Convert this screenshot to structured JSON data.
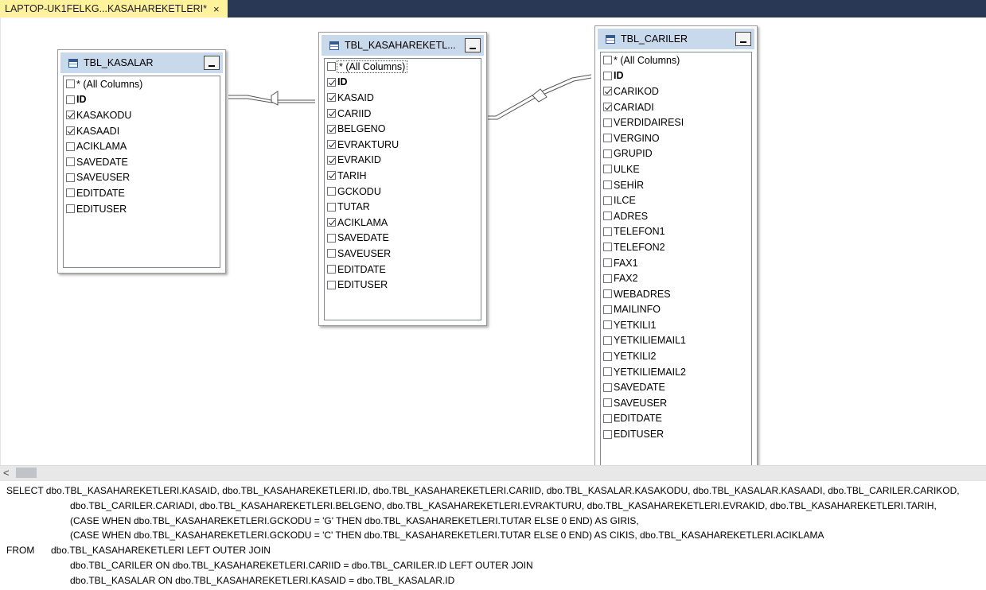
{
  "tab": {
    "title": "LAPTOP-UK1FELKG...KASAHAREKETLERI*",
    "close_glyph": "×"
  },
  "tables": {
    "kasalar": {
      "title": "TBL_KASALAR",
      "rows": [
        {
          "label": "* (All Columns)",
          "checked": false
        },
        {
          "label": "ID",
          "checked": false,
          "bold": true
        },
        {
          "label": "KASAKODU",
          "checked": true
        },
        {
          "label": "KASAADI",
          "checked": true
        },
        {
          "label": "ACIKLAMA",
          "checked": false
        },
        {
          "label": "SAVEDATE",
          "checked": false
        },
        {
          "label": "SAVEUSER",
          "checked": false
        },
        {
          "label": "EDITDATE",
          "checked": false
        },
        {
          "label": "EDITUSER",
          "checked": false
        }
      ]
    },
    "hareketler": {
      "title": "TBL_KASAHAREKETL...",
      "rows": [
        {
          "label": "* (All Columns)",
          "checked": false,
          "selected": true
        },
        {
          "label": "ID",
          "checked": true,
          "bold": true
        },
        {
          "label": "KASAID",
          "checked": true
        },
        {
          "label": "CARIID",
          "checked": true
        },
        {
          "label": "BELGENO",
          "checked": true
        },
        {
          "label": "EVRAKTURU",
          "checked": true
        },
        {
          "label": "EVRAKID",
          "checked": true
        },
        {
          "label": "TARIH",
          "checked": true
        },
        {
          "label": "GCKODU",
          "checked": false
        },
        {
          "label": "TUTAR",
          "checked": false
        },
        {
          "label": "ACIKLAMA",
          "checked": true
        },
        {
          "label": "SAVEDATE",
          "checked": false
        },
        {
          "label": "SAVEUSER",
          "checked": false
        },
        {
          "label": "EDITDATE",
          "checked": false
        },
        {
          "label": "EDITUSER",
          "checked": false
        }
      ]
    },
    "cariler": {
      "title": "TBL_CARILER",
      "rows": [
        {
          "label": "* (All Columns)",
          "checked": false
        },
        {
          "label": "ID",
          "checked": false,
          "bold": true
        },
        {
          "label": "CARIKOD",
          "checked": true
        },
        {
          "label": "CARIADI",
          "checked": true
        },
        {
          "label": "VERDIDAIRESI",
          "checked": false
        },
        {
          "label": "VERGINO",
          "checked": false
        },
        {
          "label": "GRUPID",
          "checked": false
        },
        {
          "label": "ULKE",
          "checked": false
        },
        {
          "label": "SEHİR",
          "checked": false
        },
        {
          "label": "ILCE",
          "checked": false
        },
        {
          "label": "ADRES",
          "checked": false
        },
        {
          "label": "TELEFON1",
          "checked": false
        },
        {
          "label": "TELEFON2",
          "checked": false
        },
        {
          "label": "FAX1",
          "checked": false
        },
        {
          "label": "FAX2",
          "checked": false
        },
        {
          "label": "WEBADRES",
          "checked": false
        },
        {
          "label": "MAILINFO",
          "checked": false
        },
        {
          "label": "YETKILI1",
          "checked": false
        },
        {
          "label": "YETKILIEMAIL1",
          "checked": false
        },
        {
          "label": "YETKILI2",
          "checked": false
        },
        {
          "label": "YETKILIEMAIL2",
          "checked": false
        },
        {
          "label": "SAVEDATE",
          "checked": false
        },
        {
          "label": "SAVEUSER",
          "checked": false
        },
        {
          "label": "EDITDATE",
          "checked": false
        },
        {
          "label": "EDITUSER",
          "checked": false
        }
      ]
    }
  },
  "scroll": {
    "left_arrow": "<"
  },
  "sql": {
    "lines": [
      {
        "kw": "",
        "text": "SELECT dbo.TBL_KASAHAREKETLERI.KASAID, dbo.TBL_KASAHAREKETLERI.ID, dbo.TBL_KASAHAREKETLERI.CARIID, dbo.TBL_KASALAR.KASAKODU, dbo.TBL_KASALAR.KASAADI, dbo.TBL_CARILER.CARIKOD,",
        "style": "kwl"
      },
      {
        "kw": "",
        "text": "dbo.TBL_CARILER.CARIADI, dbo.TBL_KASAHAREKETLERI.BELGENO, dbo.TBL_KASAHAREKETLERI.EVRAKTURU, dbo.TBL_KASAHAREKETLERI.EVRAKID, dbo.TBL_KASAHAREKETLERI.TARIH,",
        "style": "ind"
      },
      {
        "kw": "",
        "text": "(CASE WHEN dbo.TBL_KASAHAREKETLERI.GCKODU = 'G' THEN dbo.TBL_KASAHAREKETLERI.TUTAR ELSE 0 END) AS GIRIS,",
        "style": "ind"
      },
      {
        "kw": "",
        "text": "(CASE WHEN dbo.TBL_KASAHAREKETLERI.GCKODU = 'C' THEN dbo.TBL_KASAHAREKETLERI.TUTAR ELSE 0 END) AS CIKIS, dbo.TBL_KASAHAREKETLERI.ACIKLAMA",
        "style": "ind"
      },
      {
        "kw": "FROM",
        "text": "dbo.TBL_KASAHAREKETLERI LEFT OUTER JOIN",
        "style": "kwl"
      },
      {
        "kw": "",
        "text": "dbo.TBL_CARILER ON dbo.TBL_KASAHAREKETLERI.CARIID = dbo.TBL_CARILER.ID LEFT OUTER JOIN",
        "style": "ind"
      },
      {
        "kw": "",
        "text": "dbo.TBL_KASALAR ON dbo.TBL_KASAHAREKETLERI.KASAID = dbo.TBL_KASALAR.ID",
        "style": "ind"
      }
    ]
  }
}
